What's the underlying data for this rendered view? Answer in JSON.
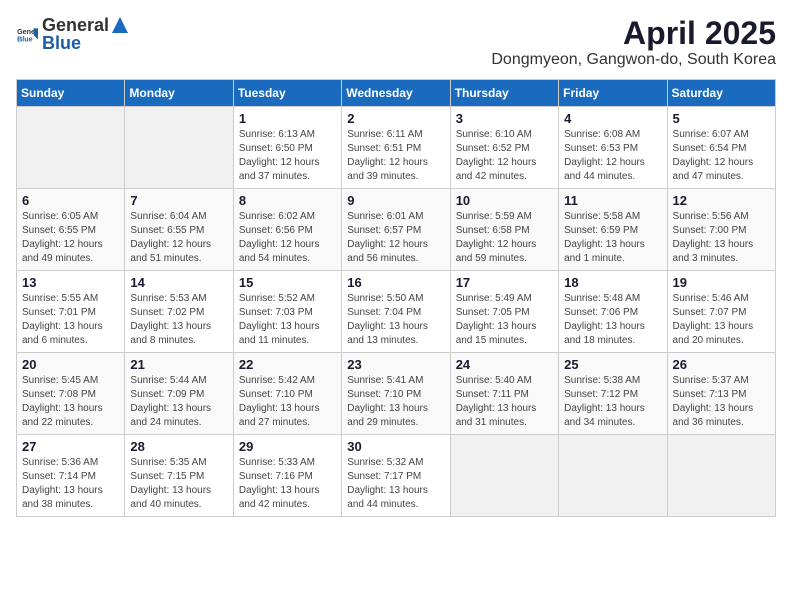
{
  "header": {
    "logo_general": "General",
    "logo_blue": "Blue",
    "title": "April 2025",
    "subtitle": "Dongmyeon, Gangwon-do, South Korea"
  },
  "days_of_week": [
    "Sunday",
    "Monday",
    "Tuesday",
    "Wednesday",
    "Thursday",
    "Friday",
    "Saturday"
  ],
  "weeks": [
    [
      {
        "day": "",
        "info": ""
      },
      {
        "day": "",
        "info": ""
      },
      {
        "day": "1",
        "info": "Sunrise: 6:13 AM\nSunset: 6:50 PM\nDaylight: 12 hours and 37 minutes."
      },
      {
        "day": "2",
        "info": "Sunrise: 6:11 AM\nSunset: 6:51 PM\nDaylight: 12 hours and 39 minutes."
      },
      {
        "day": "3",
        "info": "Sunrise: 6:10 AM\nSunset: 6:52 PM\nDaylight: 12 hours and 42 minutes."
      },
      {
        "day": "4",
        "info": "Sunrise: 6:08 AM\nSunset: 6:53 PM\nDaylight: 12 hours and 44 minutes."
      },
      {
        "day": "5",
        "info": "Sunrise: 6:07 AM\nSunset: 6:54 PM\nDaylight: 12 hours and 47 minutes."
      }
    ],
    [
      {
        "day": "6",
        "info": "Sunrise: 6:05 AM\nSunset: 6:55 PM\nDaylight: 12 hours and 49 minutes."
      },
      {
        "day": "7",
        "info": "Sunrise: 6:04 AM\nSunset: 6:55 PM\nDaylight: 12 hours and 51 minutes."
      },
      {
        "day": "8",
        "info": "Sunrise: 6:02 AM\nSunset: 6:56 PM\nDaylight: 12 hours and 54 minutes."
      },
      {
        "day": "9",
        "info": "Sunrise: 6:01 AM\nSunset: 6:57 PM\nDaylight: 12 hours and 56 minutes."
      },
      {
        "day": "10",
        "info": "Sunrise: 5:59 AM\nSunset: 6:58 PM\nDaylight: 12 hours and 59 minutes."
      },
      {
        "day": "11",
        "info": "Sunrise: 5:58 AM\nSunset: 6:59 PM\nDaylight: 13 hours and 1 minute."
      },
      {
        "day": "12",
        "info": "Sunrise: 5:56 AM\nSunset: 7:00 PM\nDaylight: 13 hours and 3 minutes."
      }
    ],
    [
      {
        "day": "13",
        "info": "Sunrise: 5:55 AM\nSunset: 7:01 PM\nDaylight: 13 hours and 6 minutes."
      },
      {
        "day": "14",
        "info": "Sunrise: 5:53 AM\nSunset: 7:02 PM\nDaylight: 13 hours and 8 minutes."
      },
      {
        "day": "15",
        "info": "Sunrise: 5:52 AM\nSunset: 7:03 PM\nDaylight: 13 hours and 11 minutes."
      },
      {
        "day": "16",
        "info": "Sunrise: 5:50 AM\nSunset: 7:04 PM\nDaylight: 13 hours and 13 minutes."
      },
      {
        "day": "17",
        "info": "Sunrise: 5:49 AM\nSunset: 7:05 PM\nDaylight: 13 hours and 15 minutes."
      },
      {
        "day": "18",
        "info": "Sunrise: 5:48 AM\nSunset: 7:06 PM\nDaylight: 13 hours and 18 minutes."
      },
      {
        "day": "19",
        "info": "Sunrise: 5:46 AM\nSunset: 7:07 PM\nDaylight: 13 hours and 20 minutes."
      }
    ],
    [
      {
        "day": "20",
        "info": "Sunrise: 5:45 AM\nSunset: 7:08 PM\nDaylight: 13 hours and 22 minutes."
      },
      {
        "day": "21",
        "info": "Sunrise: 5:44 AM\nSunset: 7:09 PM\nDaylight: 13 hours and 24 minutes."
      },
      {
        "day": "22",
        "info": "Sunrise: 5:42 AM\nSunset: 7:10 PM\nDaylight: 13 hours and 27 minutes."
      },
      {
        "day": "23",
        "info": "Sunrise: 5:41 AM\nSunset: 7:10 PM\nDaylight: 13 hours and 29 minutes."
      },
      {
        "day": "24",
        "info": "Sunrise: 5:40 AM\nSunset: 7:11 PM\nDaylight: 13 hours and 31 minutes."
      },
      {
        "day": "25",
        "info": "Sunrise: 5:38 AM\nSunset: 7:12 PM\nDaylight: 13 hours and 34 minutes."
      },
      {
        "day": "26",
        "info": "Sunrise: 5:37 AM\nSunset: 7:13 PM\nDaylight: 13 hours and 36 minutes."
      }
    ],
    [
      {
        "day": "27",
        "info": "Sunrise: 5:36 AM\nSunset: 7:14 PM\nDaylight: 13 hours and 38 minutes."
      },
      {
        "day": "28",
        "info": "Sunrise: 5:35 AM\nSunset: 7:15 PM\nDaylight: 13 hours and 40 minutes."
      },
      {
        "day": "29",
        "info": "Sunrise: 5:33 AM\nSunset: 7:16 PM\nDaylight: 13 hours and 42 minutes."
      },
      {
        "day": "30",
        "info": "Sunrise: 5:32 AM\nSunset: 7:17 PM\nDaylight: 13 hours and 44 minutes."
      },
      {
        "day": "",
        "info": ""
      },
      {
        "day": "",
        "info": ""
      },
      {
        "day": "",
        "info": ""
      }
    ]
  ]
}
